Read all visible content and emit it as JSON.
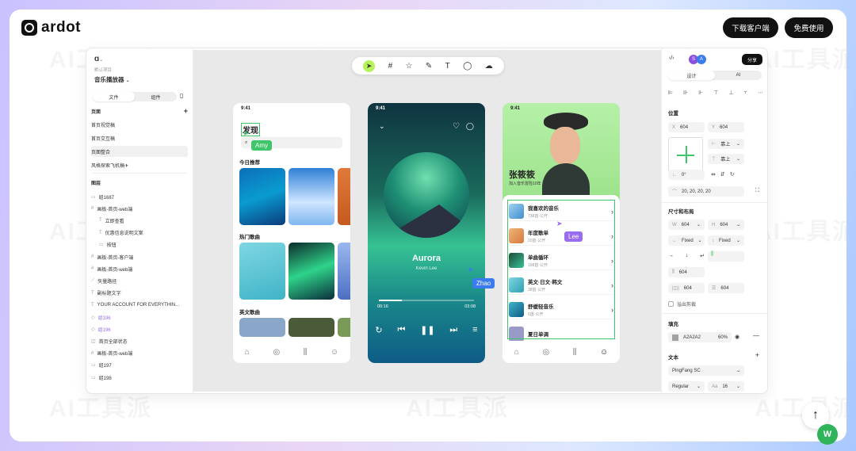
{
  "brand": {
    "name": "ardot"
  },
  "header": {
    "download": "下载客户端",
    "free": "免费使用"
  },
  "watermark": "AI工具派",
  "left_panel": {
    "project_label": "默认项目",
    "file_name": "音乐播放器",
    "tabs": [
      "文件",
      "组件"
    ],
    "pages_title": "页面",
    "pages": [
      "首页视觉稿",
      "首页交互稿",
      "页面整合",
      "风格探索飞机稿✈"
    ],
    "layers_title": "图层",
    "layers": [
      "组1687",
      "画板-首页-web端",
      "立即查看",
      "优惠信息说明文案",
      "按钮",
      "画板-首页-客户端",
      "画板-首页-web端",
      "矢量路径",
      "副标题文字",
      "YOUR ACCOUNT FOR EVERYTHIN...",
      "组196",
      "组196",
      "首页全部状态",
      "画板-首页-web端",
      "组197",
      "组198"
    ]
  },
  "phone1": {
    "time": "9:41",
    "title": "发现",
    "section1": "今日推荐",
    "section2": "热门歌曲",
    "section3": "英文歌曲"
  },
  "phone2": {
    "time": "9:41",
    "song": "Aurora",
    "artist": "Kevin Lee",
    "elapsed": "00:16",
    "total": "03:08"
  },
  "phone3": {
    "time": "9:41",
    "name": "张筱筱",
    "sub": "加入音乐冒险10年",
    "playlists": [
      {
        "title": "我喜欢的音乐",
        "sub": "738首·公开"
      },
      {
        "title": "年度歌单",
        "sub": "20首·公开"
      },
      {
        "title": "单曲循环",
        "sub": "198首·公开"
      },
      {
        "title": "英文·日文·韩文",
        "sub": "38首·公开"
      },
      {
        "title": "舒缓轻音乐",
        "sub": "6首·公开"
      },
      {
        "title": "夏日单调",
        "sub": ""
      }
    ]
  },
  "cursors": {
    "amy": "Amy",
    "lee": "Lee",
    "zhao": "Zhao"
  },
  "right_panel": {
    "avatars": [
      "S",
      "A"
    ],
    "share": "分享",
    "tabs": [
      "设计",
      "AI"
    ],
    "position_title": "位置",
    "x": "604",
    "y": "604",
    "h_constraint": "靠上",
    "v_constraint": "靠上",
    "rotation": "0°",
    "radius": "20, 20, 20, 20",
    "size_title": "尺寸和布局",
    "w": "604",
    "h": "604",
    "w_mode": "Fixed",
    "h_mode": "Fixed",
    "gap1": "604",
    "pad1": "604",
    "pad2": "604",
    "clip": "溢出剪裁",
    "fill_title": "填充",
    "fill_hex": "A2A2A2",
    "fill_opacity": "60%",
    "text_title": "文本",
    "font": "PingFang SC",
    "weight": "Regular",
    "size": "16"
  },
  "colors": {
    "accent": "#b6f25a",
    "amy": "#3fc56a",
    "lee": "#9a6cf0",
    "zhao": "#3a7cf0"
  }
}
